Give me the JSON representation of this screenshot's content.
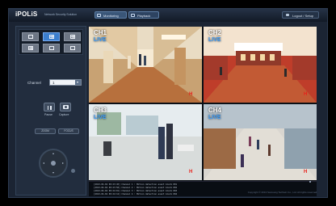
{
  "app": {
    "brand": "iPOLiS",
    "subtitle": "Network Security Solution",
    "tabs": [
      "Monitoring",
      "Playback"
    ],
    "logout_label": "Logout / Setup",
    "footer": "Copyright © 2013 Samsung Techwin Co., Ltd. All rights reserved."
  },
  "side": {
    "layout_buttons": [
      "single-view",
      "quad-view",
      "nine-view",
      "sixteen-view",
      "sequence",
      "fullscreen"
    ],
    "channel_label": "Channel",
    "channel_value": "1",
    "pause_label": "Pause",
    "capture_label": "Capture",
    "ptz_buttons": [
      "ZOOM",
      "FOCUS"
    ]
  },
  "cameras": [
    {
      "name": "CH1",
      "status": "LIVE"
    },
    {
      "name": "CH2",
      "status": "LIVE"
    },
    {
      "name": "CH3",
      "status": "LIVE"
    },
    {
      "name": "CH4",
      "status": "LIVE"
    }
  ],
  "log": [
    "[2013-04-02 09:23:45] Channel 1 : Motion detection event Alarm 001",
    "[2013-04-02 09:23:50] Channel 2 : Motion detection event Alarm 002",
    "[2013-04-02 09:24:01] Channel 3 : Motion detection event Alarm 003",
    "[2013-04-02 09:24:12] Channel 4 : Motion detection event Alarm 004"
  ],
  "colors": {
    "accent": "#3c7fcf",
    "live": "#3ea0ff",
    "record": "#e8201a"
  }
}
